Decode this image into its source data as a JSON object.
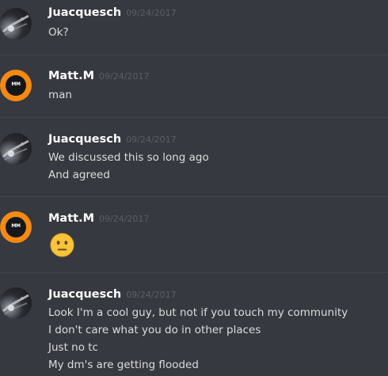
{
  "messages": [
    {
      "author": "Juacquesch",
      "timestamp": "09/24/2017",
      "avatar": "juacquesch-avatar",
      "lines": [
        "Ok?"
      ]
    },
    {
      "author": "Matt.M",
      "timestamp": "09/24/2017",
      "avatar": "matt-avatar",
      "avatar_mark": "MM",
      "lines": [
        "man"
      ]
    },
    {
      "author": "Juacquesch",
      "timestamp": "09/24/2017",
      "avatar": "juacquesch-avatar",
      "lines": [
        "We discussed this so long ago",
        "And agreed"
      ]
    },
    {
      "author": "Matt.M",
      "timestamp": "09/24/2017",
      "avatar": "matt-avatar",
      "avatar_mark": "MM",
      "emoji": "neutral-face-emoji",
      "lines": []
    },
    {
      "author": "Juacquesch",
      "timestamp": "09/24/2017",
      "avatar": "juacquesch-avatar",
      "lines": [
        "Look I'm a cool guy, but not if you touch my community",
        "I don't care what you do in other places",
        "Just no tc",
        "My dm's are getting flooded"
      ]
    }
  ],
  "colors": {
    "background": "#36393f",
    "divider": "#41444a",
    "username": "#ffffff",
    "timestamp": "#5b5e65",
    "text": "#dcddde",
    "matt_avatar": "#f48a12",
    "emoji_face": "#f9c33b"
  }
}
